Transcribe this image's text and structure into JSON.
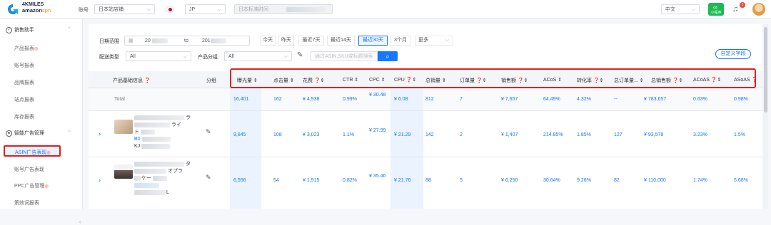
{
  "topbar": {
    "brand_top": "4KMILES",
    "brand_amazon": "amazon",
    "brand_spn": "spn",
    "account_label": "账号",
    "store_select": "日本站店铺",
    "country_select": "JP",
    "timezone_select": "日本标准时间",
    "lang_select": "中文",
    "mini_program": "小程序",
    "notification_count": "3"
  },
  "sidebar": {
    "section1": "销售助手",
    "items1": [
      "产品报表",
      "账号报表",
      "品牌报表",
      "站点报表",
      "库存报表"
    ],
    "section2": "智能广告管理",
    "items2": [
      "ASIN广告表现",
      "账号广告表现",
      "PPC广告管理",
      "策效词报表"
    ]
  },
  "filters": {
    "date_label": "日期范围",
    "date_start": "20",
    "date_to": "to",
    "date_end": "201",
    "quick": [
      "今天",
      "昨天",
      "最近7天",
      "最近14天",
      "最近30天",
      "3个月",
      "更多"
    ],
    "delivery_label": "配送类型",
    "delivery_value": "All",
    "group_label": "产品分组",
    "group_value": "All",
    "search_placeholder": "通过ASIN,SKU或标题搜索",
    "custom_fields": "自定义字段"
  },
  "table": {
    "col_product": "产品基础信息",
    "col_group": "分组",
    "metrics": [
      "曝光量",
      "点击量",
      "花费",
      "CTR",
      "CPC",
      "CPU",
      "总销量",
      "订单量",
      "销售额",
      "ACoS",
      "转化率",
      "总订单量...",
      "总销售额",
      "ACoAS",
      "ASoAS"
    ],
    "total_label": "Total",
    "total": [
      "16,401",
      "162",
      "¥ 4,938",
      "0.99%",
      "¥ 30.48",
      "¥ 6.08",
      "812",
      "7",
      "¥ 7,657",
      "64.49%",
      "4.32%",
      "--",
      "¥ 783,657",
      "0.63%",
      "0.98%"
    ],
    "row1_title": "ラ",
    "row1_title2": "ライ",
    "row1_title3": "ト",
    "row1_id1": "B0",
    "row1_id2": "KJ",
    "row1": [
      "9,845",
      "108",
      "¥ 3,023",
      "1.1%",
      "¥ 27.99",
      "¥ 21.29",
      "142",
      "2",
      "¥ 1,407",
      "214.85%",
      "1.85%",
      "127",
      "¥ 93,578",
      "3.23%",
      "1.5%"
    ],
    "row2_title": "タ",
    "row2_title2": "オプラ",
    "row2_title3": "ケー",
    "row2_id2": "L",
    "row2": [
      "6,556",
      "54",
      "¥ 1,915",
      "0.82%",
      "¥ 35.46",
      "¥ 21.76",
      "88",
      "5",
      "¥ 6,250",
      "30.64%",
      "9.26%",
      "82",
      "¥ 110,000",
      "1.74%",
      "5.68%"
    ]
  }
}
